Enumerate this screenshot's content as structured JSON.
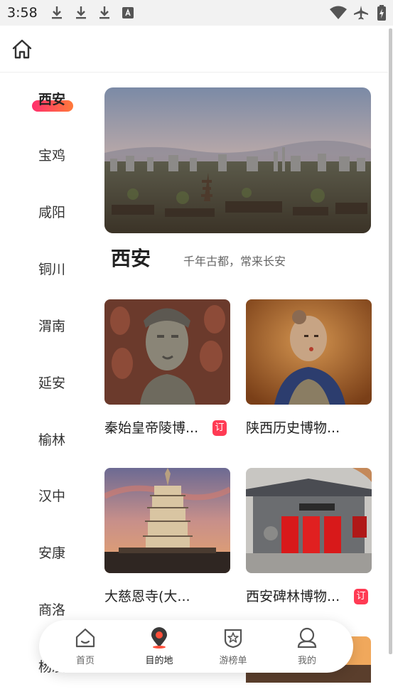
{
  "status_bar": {
    "time": "3:58"
  },
  "sidebar": {
    "active": "西安",
    "cities": [
      "西安",
      "宝鸡",
      "咸阳",
      "铜川",
      "渭南",
      "延安",
      "榆林",
      "汉中",
      "安康",
      "商洛",
      "杨凌"
    ]
  },
  "city": {
    "title": "西安",
    "slogan": "千年古都，常来长安"
  },
  "attractions": [
    {
      "title": "秦始皇帝陵博...",
      "badge": "订"
    },
    {
      "title": "陕西历史博物..."
    },
    {
      "title": "大慈恩寺(大..."
    },
    {
      "title": "西安碑林博物...",
      "badge": "订"
    }
  ],
  "tabbar": {
    "items": [
      "首页",
      "目的地",
      "游榜单",
      "我的"
    ],
    "active": "目的地"
  },
  "colors": {
    "accent": "#ff3b54",
    "gradient_start": "#ff2f6d",
    "gradient_end": "#ff7a3a"
  }
}
